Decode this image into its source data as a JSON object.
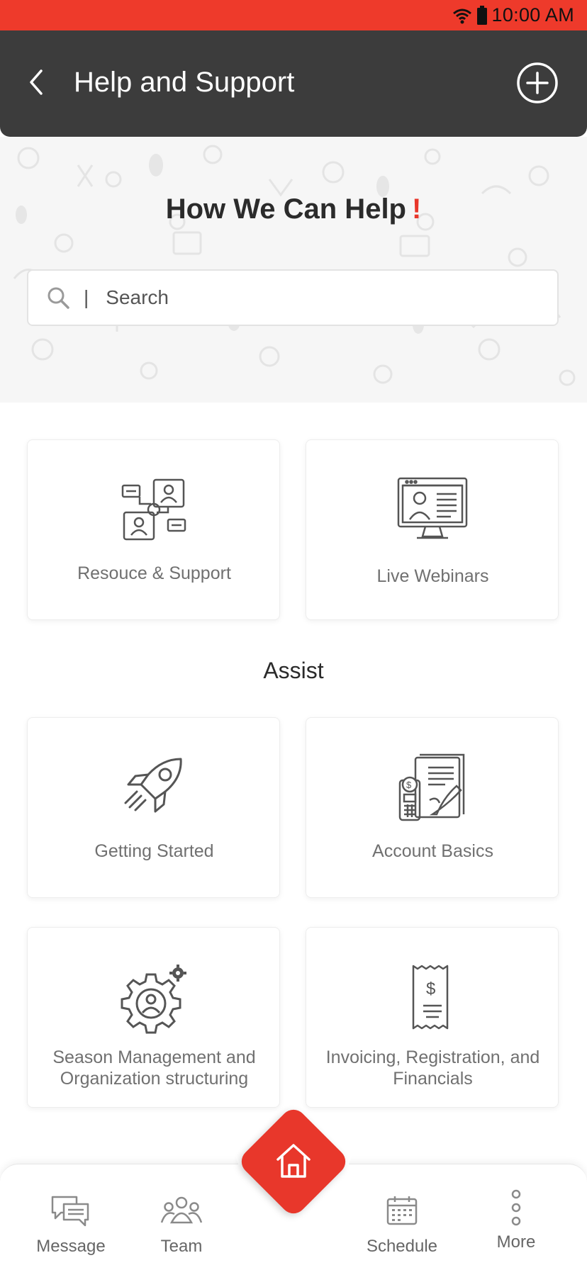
{
  "status_bar": {
    "time": "10:00 AM",
    "icons": [
      "wifi-icon",
      "battery-icon"
    ]
  },
  "header": {
    "title": "Help and Support",
    "back_icon": "chevron-left-icon",
    "action_icon": "plus-circle-icon"
  },
  "hero": {
    "title": "How We Can Help",
    "title_accent": "!",
    "search": {
      "placeholder": "Search",
      "divider": "|",
      "icon": "search-icon"
    }
  },
  "top_cards": [
    {
      "label": "Resouce & Support",
      "icon": "resource-network-icon"
    },
    {
      "label": "Live Webinars",
      "icon": "webinar-monitor-icon"
    }
  ],
  "assist": {
    "title": "Assist",
    "cards": [
      {
        "label": "Getting Started",
        "icon": "rocket-icon"
      },
      {
        "label": "Account Basics",
        "icon": "account-document-icon"
      },
      {
        "label": "Season Management and Organization structuring",
        "icon": "user-gear-icon"
      },
      {
        "label": "Invoicing, Registration, and Financials",
        "icon": "receipt-icon"
      }
    ]
  },
  "bottom_nav": {
    "items": [
      {
        "label": "Message",
        "icon": "message-icon"
      },
      {
        "label": "Team",
        "icon": "team-icon"
      },
      {
        "label": "Schedule",
        "icon": "calendar-icon"
      },
      {
        "label": "More",
        "icon": "more-vertical-icon"
      }
    ],
    "home_icon": "home-icon"
  },
  "colors": {
    "brand_red": "#e8372b",
    "header_bg": "#3c3c3c",
    "text_dark": "#2b2b2b",
    "text_muted": "#707070"
  }
}
